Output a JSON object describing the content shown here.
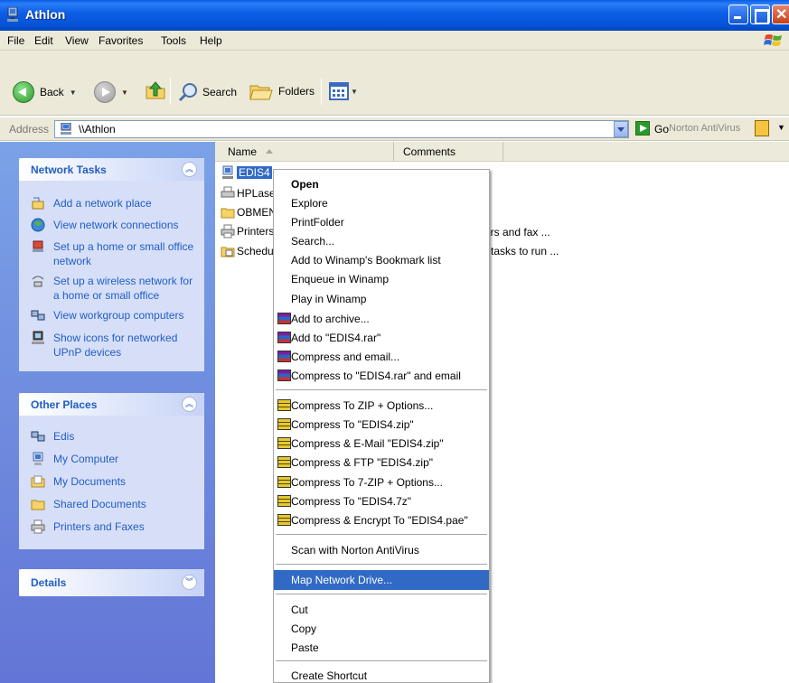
{
  "window": {
    "title": "Athlon"
  },
  "menubar": [
    "File",
    "Edit",
    "View",
    "Favorites",
    "Tools",
    "Help"
  ],
  "toolbar": {
    "back": "Back",
    "search": "Search",
    "folders": "Folders"
  },
  "address": {
    "label": "Address",
    "value": "\\\\Athlon",
    "go": "Go",
    "norton": "Norton AntiVirus"
  },
  "left": {
    "network_tasks": {
      "title": "Network Tasks",
      "items": [
        "Add a network place",
        "View network connections",
        "Set up a home or small office network",
        "Set up a wireless network for a home or small office",
        "View workgroup computers",
        "Show icons for networked UPnP devices"
      ]
    },
    "other_places": {
      "title": "Other Places",
      "items": [
        "Edis",
        "My Computer",
        "My Documents",
        "Shared Documents",
        "Printers and Faxes"
      ]
    },
    "details": {
      "title": "Details"
    }
  },
  "columns": {
    "name": "Name",
    "comments": "Comments"
  },
  "files": [
    {
      "name": "EDIS4",
      "comment": ""
    },
    {
      "name": "HPLase",
      "comment": ""
    },
    {
      "name": "OBMEN",
      "comment": ""
    },
    {
      "name": "Printers",
      "comment": "nters and fax ..."
    },
    {
      "name": "Schedu",
      "comment": "tasks to run ..."
    }
  ],
  "context_menu": {
    "group1": [
      "Open",
      "Explore",
      "PrintFolder",
      "Search...",
      "Add to Winamp's Bookmark list",
      "Enqueue in Winamp",
      "Play in Winamp",
      "Add to archive...",
      "Add to \"EDIS4.rar\"",
      "Compress and email...",
      "Compress to \"EDIS4.rar\" and email"
    ],
    "group2": [
      "Compress To ZIP + Options...",
      "Compress To \"EDIS4.zip\"",
      "Compress & E-Mail \"EDIS4.zip\"",
      "Compress & FTP \"EDIS4.zip\"",
      "Compress To 7-ZIP + Options...",
      "Compress To \"EDIS4.7z\"",
      "Compress & Encrypt To \"EDIS4.pae\""
    ],
    "group3": [
      "Scan with Norton AntiVirus"
    ],
    "group4": [
      "Map Network Drive..."
    ],
    "group5": [
      "Cut",
      "Copy",
      "Paste"
    ],
    "group6": [
      "Create Shortcut"
    ]
  }
}
